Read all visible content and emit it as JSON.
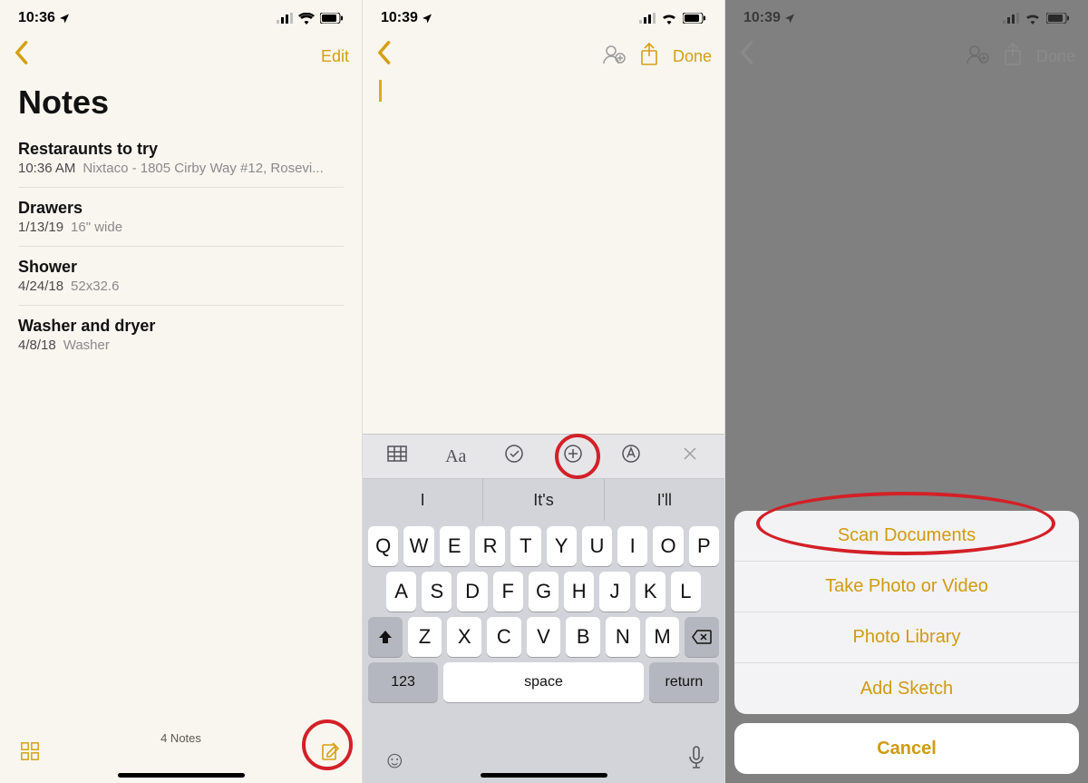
{
  "status": {
    "time1": "10:36",
    "time2": "10:39",
    "time3": "10:39"
  },
  "screen1": {
    "edit": "Edit",
    "title": "Notes",
    "notes": [
      {
        "title": "Restaraunts to try",
        "date": "10:36 AM",
        "preview": "Nixtaco - 1805 Cirby Way #12, Rosevi..."
      },
      {
        "title": "Drawers",
        "date": "1/13/19",
        "preview": "16\" wide"
      },
      {
        "title": "Shower",
        "date": "4/24/18",
        "preview": "52x32.6"
      },
      {
        "title": "Washer and dryer",
        "date": "4/8/18",
        "preview": "Washer"
      }
    ],
    "count": "4 Notes"
  },
  "screen2": {
    "done": "Done",
    "toolbar": {
      "aa": "Aa"
    },
    "suggestions": [
      "I",
      "It's",
      "I'll"
    ],
    "rows": {
      "r1": [
        "Q",
        "W",
        "E",
        "R",
        "T",
        "Y",
        "U",
        "I",
        "O",
        "P"
      ],
      "r2": [
        "A",
        "S",
        "D",
        "F",
        "G",
        "H",
        "J",
        "K",
        "L"
      ],
      "r3": [
        "Z",
        "X",
        "C",
        "V",
        "B",
        "N",
        "M"
      ]
    },
    "numkey": "123",
    "space": "space",
    "return": "return"
  },
  "screen3": {
    "done": "Done",
    "options": [
      "Scan Documents",
      "Take Photo or Video",
      "Photo Library",
      "Add Sketch"
    ],
    "cancel": "Cancel"
  }
}
